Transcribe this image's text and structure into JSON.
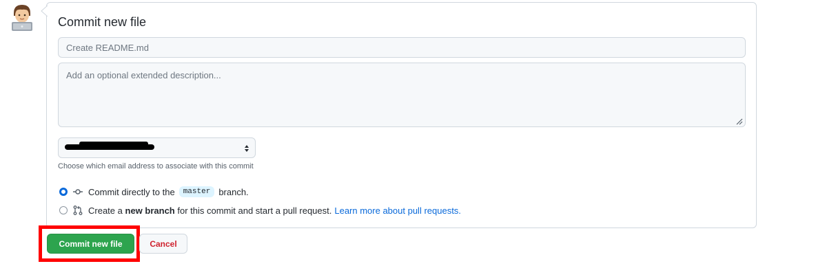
{
  "avatar": {
    "icon": "developer-avatar-icon"
  },
  "commit_form": {
    "title": "Commit new file",
    "summary": {
      "placeholder": "Create README.md",
      "value": ""
    },
    "description": {
      "placeholder": "Add an optional extended description...",
      "value": ""
    },
    "email_select": {
      "selected_value": "[redacted email]",
      "redacted": true
    },
    "email_help": "Choose which email address to associate with this commit",
    "options": [
      {
        "checked": true,
        "icon": "git-commit-icon",
        "text_before": "Commit directly to the",
        "branch": "master",
        "text_after": "branch."
      },
      {
        "checked": false,
        "icon": "git-pull-request-icon",
        "text_before": "Create a",
        "bold": "new branch",
        "text_after": "for this commit and start a pull request.",
        "link": "Learn more about pull requests."
      }
    ],
    "buttons": {
      "commit": "Commit new file",
      "cancel": "Cancel"
    }
  },
  "colors": {
    "primary_green": "#2da44e",
    "cancel_red": "#cf222e",
    "link_blue": "#0969da",
    "highlight_red": "#ff0000"
  }
}
